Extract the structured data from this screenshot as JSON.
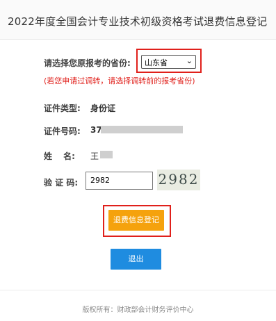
{
  "header": {
    "title": "2022年度全国会计专业技术初级资格考试退费信息登记"
  },
  "form": {
    "province_label": "请选择您原报考的省份:",
    "province_value": "山东省",
    "note": "(若您申请过调转，请选择调转前的报考省份)",
    "id_type_label": "证件类型:",
    "id_type_value": "身份证",
    "id_number_label": "证件号码:",
    "id_number_prefix": "37",
    "name_label": "姓　 名:",
    "name_prefix": "王",
    "captcha_label": "验 证 码:",
    "captcha_input_value": "2982",
    "captcha_image_text": "2982"
  },
  "buttons": {
    "register": "退费信息登记",
    "exit": "退出"
  },
  "footer": {
    "copyright": "版权所有：财政部会计财务评价中心"
  },
  "colors": {
    "highlight_red": "#e0201b",
    "orange_button": "#f5a20d",
    "blue_button": "#1f8ce0"
  }
}
